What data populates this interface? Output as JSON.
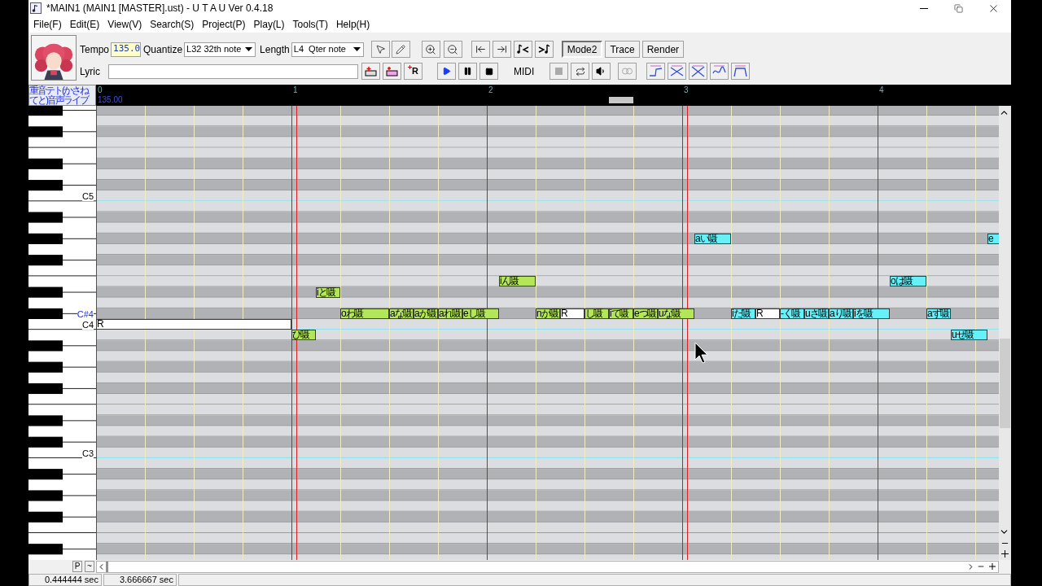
{
  "window": {
    "title": "*MAIN1 (MAIN1 [MASTER].ust) - U T A U Ver 0.4.18"
  },
  "menu": [
    "File(F)",
    "Edit(E)",
    "View(V)",
    "Search(S)",
    "Project(P)",
    "Play(L)",
    "Tools(T)",
    "Help(H)"
  ],
  "toolbar": {
    "tempo_label": "Tempo",
    "tempo": "135.0",
    "quantize_label": "Quantize",
    "quantize": "L32 32th note",
    "length_label": "Length",
    "length": "L4  Qter note",
    "lyric_label": "Lyric",
    "rest_button_label": "R",
    "midi_label": "MIDI",
    "mode_buttons": [
      {
        "label": "Mode2",
        "pressed": true
      },
      {
        "label": "Trace",
        "pressed": false
      },
      {
        "label": "Render",
        "pressed": false
      }
    ]
  },
  "voice_name": "重音テト(かさねてと)音声ライブ",
  "ruler": {
    "tempo": "135.00",
    "measures": [
      "0",
      "1",
      "2",
      "3",
      "4"
    ]
  },
  "key_labels": [
    {
      "text": "C5",
      "highlighted": false
    },
    {
      "text": "C#4",
      "highlighted": true
    },
    {
      "text": "C4",
      "highlighted": false
    },
    {
      "text": "C3",
      "highlighted": false
    }
  ],
  "notes": [
    {
      "lyric": "R",
      "color": "#ffffff"
    },
    {
      "lyric": "ひ嗫",
      "color": "#b4e65a"
    },
    {
      "lyric": "i と嗫",
      "color": "#b4e65a"
    },
    {
      "lyric": "o わ嗫",
      "color": "#b4e65a"
    },
    {
      "lyric": "a な嗫",
      "color": "#b4e65a"
    },
    {
      "lyric": "a が嗫",
      "color": "#b4e65a"
    },
    {
      "lyric": "a れ嗫",
      "color": "#b4e65a"
    },
    {
      "lyric": "e し嗫",
      "color": "#b4e65a"
    },
    {
      "lyric": "i ん嗫",
      "color": "#b4e65a"
    },
    {
      "lyric": "n か嗫",
      "color": "#b4e65a"
    },
    {
      "lyric": "R",
      "color": "#ffffff"
    },
    {
      "lyric": "し嗫",
      "color": "#b4e65a"
    },
    {
      "lyric": "i て嗫",
      "color": "#b4e65a"
    },
    {
      "lyric": "e つ嗫",
      "color": "#b4e65a"
    },
    {
      "lyric": "u な嗫",
      "color": "#b4e65a"
    },
    {
      "lyric": "a い嗫",
      "color": "#66f0f8"
    },
    {
      "lyric": "i だ嗫",
      "color": "#66f0f8"
    },
    {
      "lyric": "R",
      "color": "#ffffff"
    },
    {
      "lyric": "- く嗫",
      "color": "#66f0f8"
    },
    {
      "lyric": "u さ嗫",
      "color": "#66f0f8"
    },
    {
      "lyric": "a り嗫",
      "color": "#66f0f8"
    },
    {
      "lyric": "i を嗫",
      "color": "#66f0f8"
    },
    {
      "lyric": "o は嗫",
      "color": "#66f0f8"
    },
    {
      "lyric": "a ず嗫",
      "color": "#66f0f8"
    },
    {
      "lyric": "u せ嗫",
      "color": "#66f0f8"
    },
    {
      "lyric": "e",
      "color": "#66f0f8"
    }
  ],
  "bottom_buttons": [
    "P",
    "~"
  ],
  "status_bar": [
    "0.444444 sec",
    "3.666667 sec"
  ]
}
